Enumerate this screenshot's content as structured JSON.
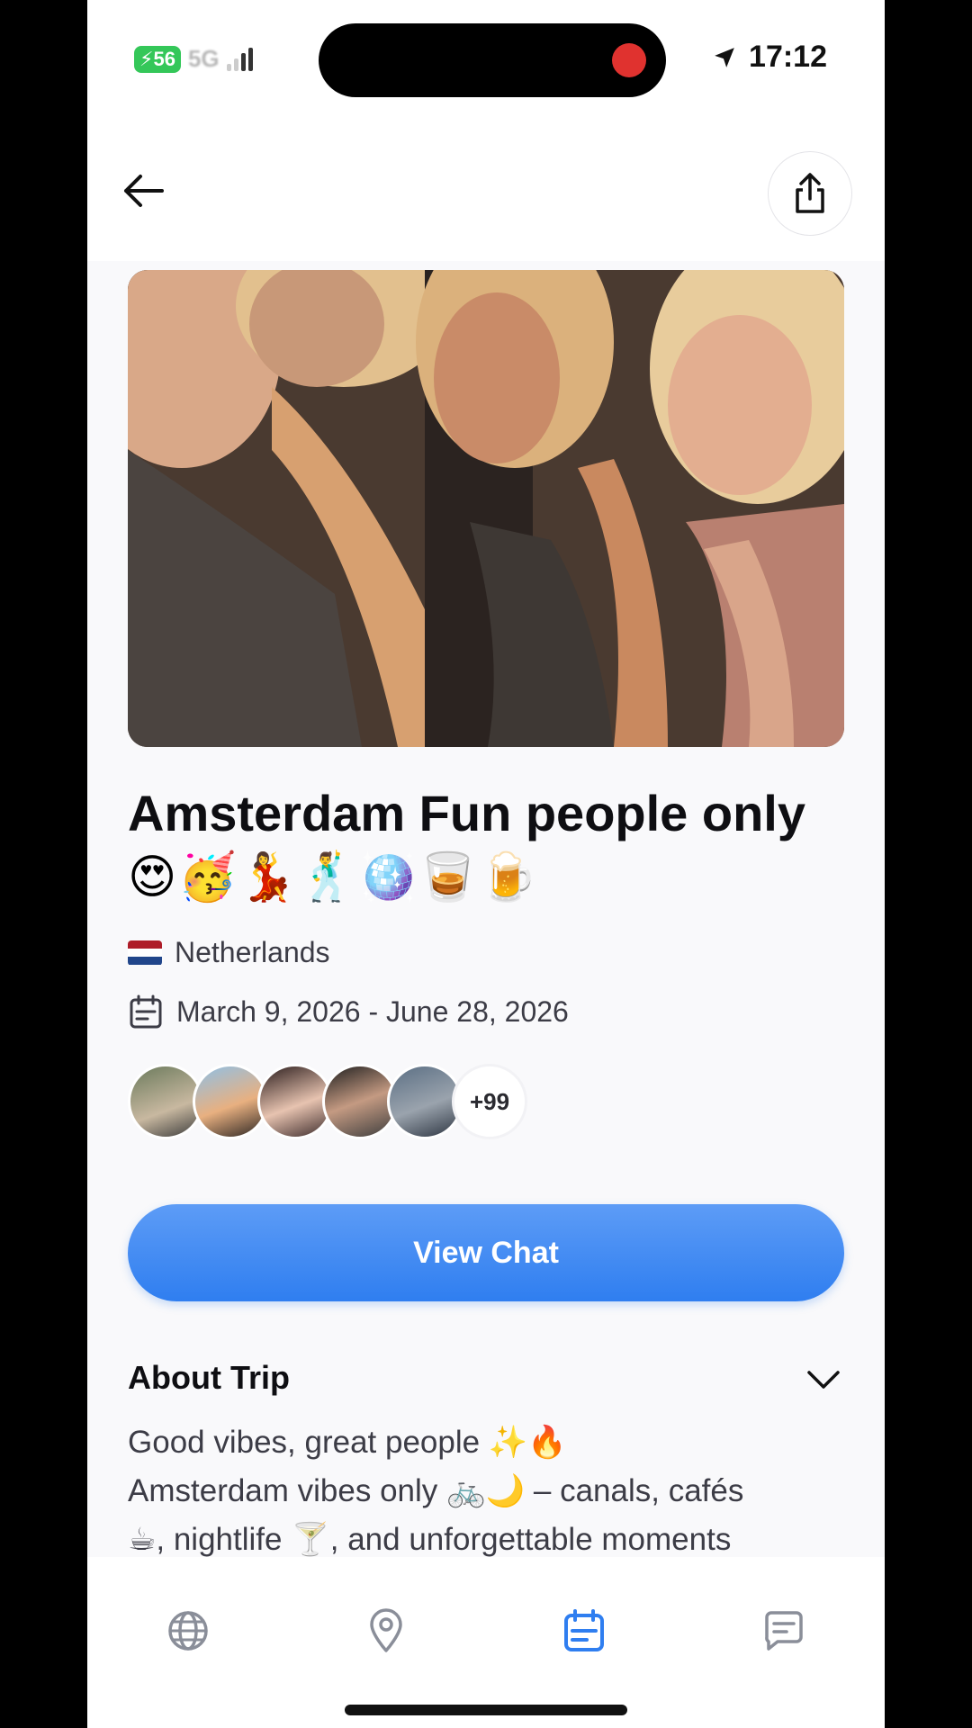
{
  "status_bar": {
    "battery": "56",
    "network": "5G",
    "time": "17:12"
  },
  "trip": {
    "title": "Amsterdam Fun people only",
    "emojis": "😍🥳💃🕺🪩🥃🍺",
    "country": "Netherlands",
    "dates": "March 9, 2026 - June 28, 2026",
    "members_more": "+99"
  },
  "actions": {
    "view_chat_label": "View Chat"
  },
  "about": {
    "heading": "About Trip",
    "line1": "Good vibes, great people ✨🔥",
    "line2": "Amsterdam vibes only 🚲🌙 – canals, cafés",
    "line3": "☕, nightlife 🍸, and unforgettable moments"
  },
  "nav": {
    "items": [
      "explore",
      "places",
      "trips",
      "chats"
    ],
    "active": "trips"
  },
  "colors": {
    "accent": "#2f7ef0",
    "nav_inactive": "#8a8e99",
    "flag_red": "#ae1c28",
    "flag_blue": "#21468b"
  }
}
